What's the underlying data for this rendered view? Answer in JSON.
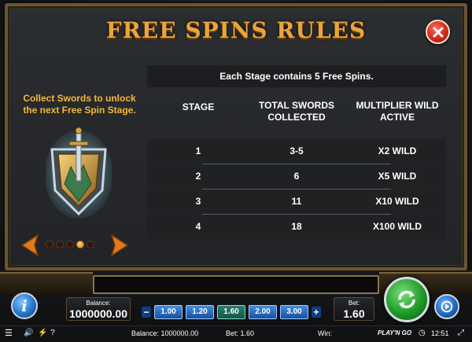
{
  "title": "FREE SPINS RULES",
  "left_panel": {
    "collect_text": "Collect Swords to unlock the next Free Spin Stage.",
    "page_dots": 5,
    "active_dot": 4
  },
  "table": {
    "note": "Each Stage contains 5 Free Spins.",
    "headers": {
      "stage": "STAGE",
      "swords": "TOTAL SWORDS COLLECTED",
      "multiplier": "MULTIPLIER WILD ACTIVE"
    },
    "rows": [
      {
        "stage": "1",
        "swords": "3-5",
        "multiplier": "X2 WILD"
      },
      {
        "stage": "2",
        "swords": "6",
        "multiplier": "X5 WILD"
      },
      {
        "stage": "3",
        "swords": "11",
        "multiplier": "X10 WILD"
      },
      {
        "stage": "4",
        "swords": "18",
        "multiplier": "X100 WILD"
      }
    ]
  },
  "controls": {
    "balance_label": "Balance:",
    "balance_value": "1000000.00",
    "bet_label": "Bet:",
    "bet_value": "1.60",
    "minus": "−",
    "plus": "+",
    "bet_options": [
      "1.00",
      "1.20",
      "1.60",
      "2.00",
      "3.00"
    ],
    "selected_bet_index": 2
  },
  "status_bar": {
    "balance": "Balance: 1000000.00",
    "bet": "Bet: 1.60",
    "win": "Win:",
    "brand": "PLAY'N GO",
    "time": "12:51"
  },
  "colors": {
    "title": "#e9a53a",
    "collect_text": "#f4b73c",
    "close_button": "#d22a1a",
    "spin_button": "#1f9a28",
    "selected_bet": "#145448"
  }
}
